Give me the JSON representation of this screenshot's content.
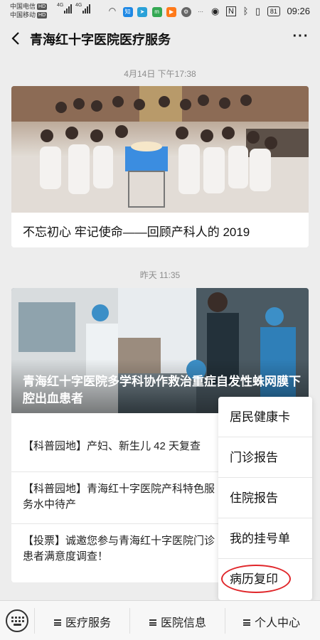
{
  "status": {
    "carrier1": "中国电信",
    "carrier2": "中国移动",
    "hd": "HD",
    "net1": "4G",
    "net2": "4G",
    "battery": "81",
    "time": "09:26"
  },
  "nav": {
    "title": "青海红十字医院医疗服务",
    "more": "···"
  },
  "feed": [
    {
      "time": "4月14日 下午17:38",
      "title": "不忘初心 牢记使命——回顾产科人的 2019"
    },
    {
      "time": "昨天 11:35",
      "cover_title": "青海红十字医院多学科协作救治重症自发性蛛网膜下腔出血患者",
      "articles": [
        "【科普园地】产妇、新生儿 42 天复查",
        "【科普园地】青海红十字医院产科特色服务水中待产",
        "【投票】诚邀您参与青海红十字医院门诊患者满意度调查！"
      ]
    }
  ],
  "popup_menu": [
    "居民健康卡",
    "门诊报告",
    "住院报告",
    "我的挂号单",
    "病历复印"
  ],
  "bottom_menu": [
    "医疗服务",
    "医院信息",
    "个人中心"
  ],
  "colors": {
    "background": "#ededed",
    "highlight_circle": "#e0262a"
  }
}
